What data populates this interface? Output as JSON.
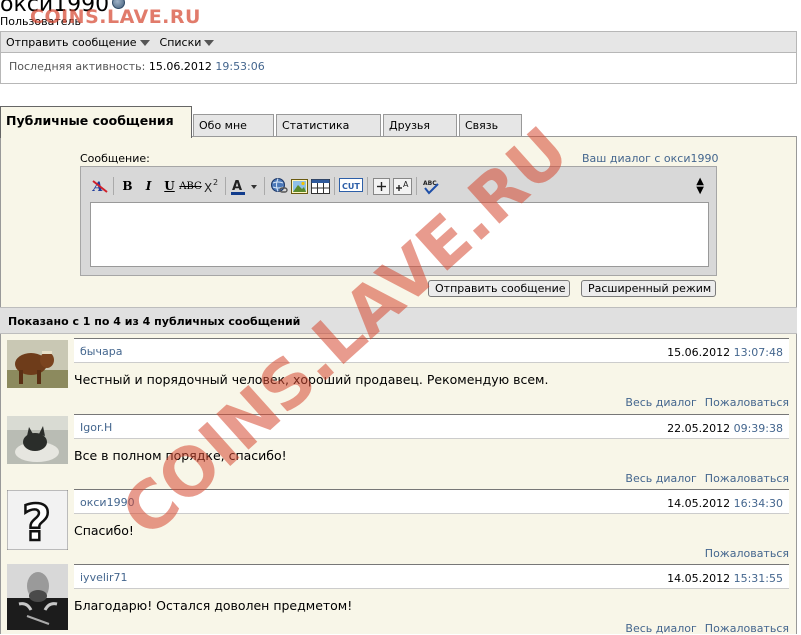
{
  "profile": {
    "username": "окси1990",
    "usertitle": "Пользователь",
    "last_activity_label": "Последняя активность:",
    "last_activity_date": "15.06.2012",
    "last_activity_time": "19:53:06"
  },
  "toolbar": {
    "send_message": "Отправить сообщение",
    "lists": "Списки"
  },
  "tabs": [
    {
      "label": "Публичные сообщения",
      "active": true
    },
    {
      "label": "Обо мне"
    },
    {
      "label": "Статистика"
    },
    {
      "label": "Друзья"
    },
    {
      "label": "Связь"
    }
  ],
  "editor": {
    "label": "Сообщение:",
    "dialog_link": "Ваш диалог с окси1990",
    "icons": [
      "remove-format-icon",
      "bold-icon",
      "italic-icon",
      "underline-icon",
      "strikethrough-icon",
      "superscript-icon",
      "text-color-icon",
      "insert-link-icon",
      "insert-image-icon",
      "insert-table-icon",
      "cut-tag-icon",
      "increase-size-icon",
      "decrease-size-icon",
      "spellcheck-icon",
      "resize-arrows-icon"
    ],
    "textarea_value": "",
    "submit_label": "Отправить сообщение",
    "advanced_label": "Расширенный режим"
  },
  "summary": "Показано с 1 по 4 из 4 публичных сообщений",
  "messages": [
    {
      "author": "бычара",
      "date": "15.06.2012",
      "time": "13:07:48",
      "text": "Честный и порядочный человек, хороший продавец. Рекомендую всем.",
      "dialog_link": "Весь диалог",
      "report_link": "Пожаловаться",
      "avatar": "bull-avatar"
    },
    {
      "author": "Igor.H",
      "date": "22.05.2012",
      "time": "09:39:38",
      "text": "Все в полном порядке, спасибо!",
      "dialog_link": "Весь диалог",
      "report_link": "Пожаловаться",
      "avatar": "cat-avatar"
    },
    {
      "author": "окси1990",
      "date": "14.05.2012",
      "time": "16:34:30",
      "text": "Спасибо!",
      "dialog_link": "",
      "report_link": "Пожаловаться",
      "avatar": "question-mark-avatar"
    },
    {
      "author": "iyvelir71",
      "date": "14.05.2012",
      "time": "15:31:55",
      "text": "Благодарю! Остался доволен предметом!",
      "dialog_link": "Весь диалог",
      "report_link": "Пожаловаться",
      "avatar": "portrait-avatar"
    }
  ],
  "watermark": {
    "text": "COINS.LAVE.RU",
    "color": "#d64832"
  },
  "colors": {
    "link": "#44668e",
    "panel": "#f8f6e8",
    "toolbar": "#e6e6e6"
  }
}
